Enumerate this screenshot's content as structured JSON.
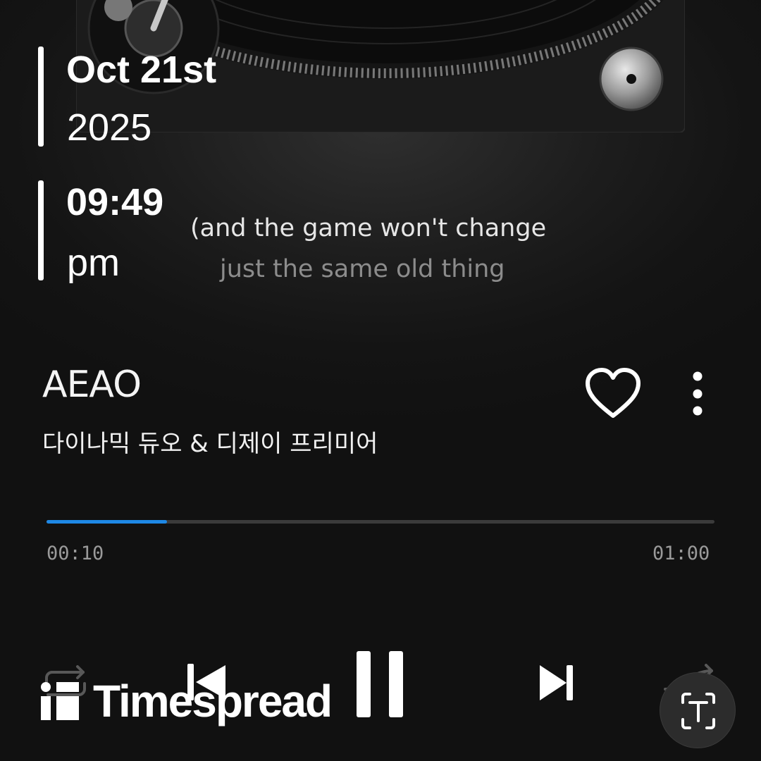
{
  "date": {
    "month_day": "Oct 21st",
    "year": "2025"
  },
  "time": {
    "clock": "09:49",
    "period": "pm"
  },
  "lyrics": {
    "current_line": "(and the game won't change",
    "next_line": "just the same old thing"
  },
  "song": {
    "title": "AEAO",
    "artist": "다이나믹 듀오 & 디제이 프리미어",
    "liked": false
  },
  "playback": {
    "elapsed": "00:10",
    "duration": "01:00",
    "progress_fraction": 0.18,
    "state": "playing"
  },
  "controls": {
    "repeat_icon": "repeat-icon",
    "previous_icon": "skip-previous-icon",
    "pause_icon": "pause-icon",
    "next_icon": "skip-next-icon",
    "shuffle_icon": "shuffle-icon"
  },
  "watermark": {
    "text": "Timespread"
  },
  "colors": {
    "accent": "#1e88e5",
    "background": "#141414",
    "lyric_current": "#e6e6e6",
    "lyric_next": "#8c8c8c",
    "time_label": "#9a9a9a"
  }
}
